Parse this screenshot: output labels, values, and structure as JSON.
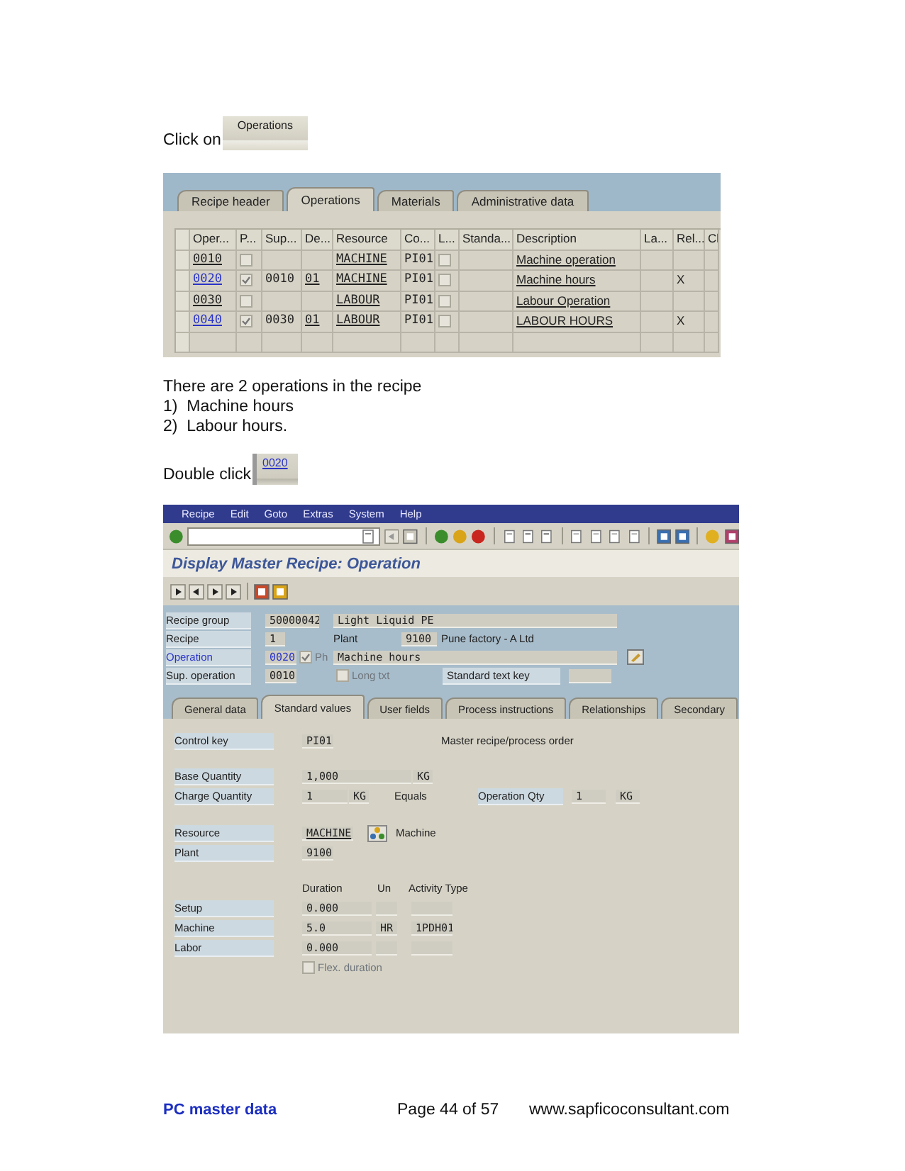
{
  "instruction_1": {
    "text": "Click on",
    "button": "Operations"
  },
  "operations_screen": {
    "tabs": [
      {
        "label": "Recipe header",
        "selected": false
      },
      {
        "label": "Operations",
        "selected": true
      },
      {
        "label": "Materials",
        "selected": false
      },
      {
        "label": "Administrative data",
        "selected": false
      }
    ],
    "columns": [
      "Oper...",
      "P...",
      "Sup...",
      "De...",
      "Resource",
      "Co...",
      "L...",
      "Standa...",
      "Description",
      "La...",
      "Rel...",
      "Cl"
    ],
    "rows": [
      {
        "operation": "0010",
        "linked": false,
        "phase": false,
        "resource": "MACHINE",
        "control_key": "PI01",
        "long_text": false,
        "description": "Machine operation"
      },
      {
        "operation": "0020",
        "linked": true,
        "phase": true,
        "superior": "0010",
        "destination": "01",
        "resource": "MACHINE",
        "control_key": "PI01",
        "long_text": false,
        "description": "Machine hours",
        "relevant": "X"
      },
      {
        "operation": "0030",
        "linked": false,
        "phase": false,
        "resource": "LABOUR",
        "control_key": "PI01",
        "long_text": false,
        "description": "Labour Operation"
      },
      {
        "operation": "0040",
        "linked": true,
        "phase": true,
        "superior": "0030",
        "destination": "01",
        "resource": "LABOUR",
        "control_key": "PI01",
        "long_text": false,
        "description": "LABOUR HOURS",
        "relevant": "X"
      }
    ]
  },
  "notes": [
    "There are 2 operations in the recipe",
    "1)  Machine hours",
    "2)  Labour hours."
  ],
  "instruction_2": {
    "text": "Double click",
    "button": "0020"
  },
  "recipe_screen": {
    "menu": [
      "Recipe",
      "Edit",
      "Goto",
      "Extras",
      "System",
      "Help"
    ],
    "title": "Display Master Recipe: Operation",
    "header": {
      "recipe_group": {
        "label": "Recipe group",
        "value": "50000042",
        "text": "Light Liquid PE"
      },
      "recipe": {
        "label": "Recipe",
        "value": "1",
        "plant_label": "Plant",
        "plant": "9100",
        "plant_name": "Pune factory -  A Ltd"
      },
      "operation": {
        "label": "Operation",
        "value": "0020",
        "phase_label": "Ph",
        "phase_checked": true,
        "text": "Machine hours"
      },
      "sup_operation": {
        "label": "Sup. operation",
        "value": "0010",
        "long_text_label": "Long txt",
        "long_text_checked": false,
        "std_text_label": "Standard text key"
      }
    },
    "tabs": [
      {
        "label": "General data",
        "selected": false
      },
      {
        "label": "Standard values",
        "selected": true
      },
      {
        "label": "User fields",
        "selected": false
      },
      {
        "label": "Process instructions",
        "selected": false
      },
      {
        "label": "Relationships",
        "selected": false
      },
      {
        "label": "Secondary",
        "selected": false
      }
    ],
    "control_key": {
      "label": "Control key",
      "value": "PI01",
      "text": "Master recipe/process order"
    },
    "base_quantity": {
      "label": "Base Quantity",
      "value": "1,000",
      "unit": "KG"
    },
    "charge_quantity": {
      "label": "Charge Quantity",
      "value": "1",
      "unit": "KG",
      "equals": "Equals",
      "op_label": "Operation Qty",
      "op_value": "1",
      "op_unit": "KG"
    },
    "resource": {
      "label": "Resource",
      "value": "MACHINE",
      "text": "Machine"
    },
    "plant": {
      "label": "Plant",
      "value": "9100"
    },
    "durations": {
      "columns": [
        "Duration",
        "Un",
        "Activity Type"
      ],
      "rows": [
        {
          "label": "Setup",
          "duration": "0.000"
        },
        {
          "label": "Machine",
          "duration": "5.0",
          "unit": "HR",
          "activity": "1PDH01"
        },
        {
          "label": "Labor",
          "duration": "0.000"
        }
      ]
    },
    "flex_duration": {
      "label": "Flex. duration",
      "checked": false
    }
  },
  "footer": {
    "left": "PC master data",
    "center": "Page 44 of 57",
    "right": "www.sapficoconsultant.com"
  }
}
